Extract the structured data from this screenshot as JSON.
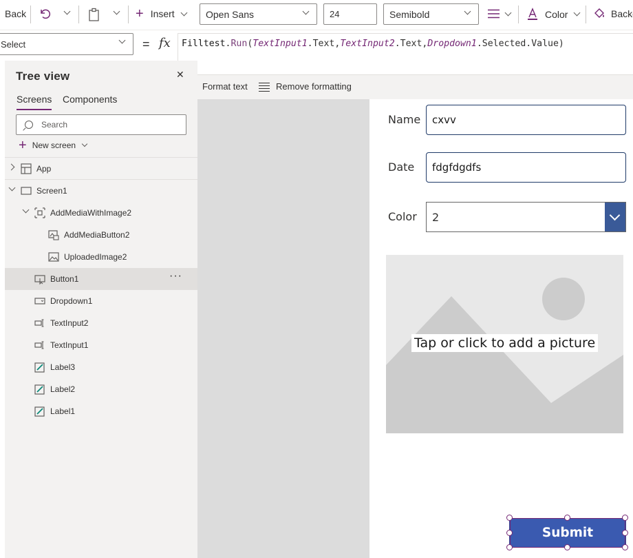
{
  "toolbar": {
    "back_label": "Back",
    "insert_label": "Insert",
    "font_family": "Open Sans",
    "font_size": "24",
    "font_weight": "Semibold",
    "color_label": "Color",
    "background_label": "Backg"
  },
  "formula_bar": {
    "property": "Select",
    "equals": "=",
    "fx_label": "fx",
    "formula": {
      "fn": "Filltest",
      "method": "Run",
      "arg1_ctrl": "TextInput1",
      "arg1_prop": ".Text,",
      "arg2_ctrl": "TextInput2",
      "arg2_prop": ".Text,",
      "arg3_ctrl": "Dropdown1",
      "arg3_prop": ".Selected.Value)"
    },
    "format_text_label": "Format text",
    "remove_formatting_label": "Remove formatting"
  },
  "tree": {
    "title": "Tree view",
    "close_glyph": "✕",
    "tabs": [
      "Screens",
      "Components"
    ],
    "search_placeholder": "Search",
    "new_screen_label": "New screen",
    "items": [
      {
        "label": "App",
        "icon": "app-icon"
      },
      {
        "label": "Screen1",
        "icon": "screen-icon"
      },
      {
        "label": "AddMediaWithImage2",
        "icon": "group-icon"
      },
      {
        "label": "AddMediaButton2",
        "icon": "add-media-icon"
      },
      {
        "label": "UploadedImage2",
        "icon": "image-icon"
      },
      {
        "label": "Button1",
        "icon": "button-icon",
        "selected": true
      },
      {
        "label": "Dropdown1",
        "icon": "dropdown-icon"
      },
      {
        "label": "TextInput2",
        "icon": "text-input-icon"
      },
      {
        "label": "TextInput1",
        "icon": "text-input-icon"
      },
      {
        "label": "Label3",
        "icon": "label-icon"
      },
      {
        "label": "Label2",
        "icon": "label-icon"
      },
      {
        "label": "Label1",
        "icon": "label-icon"
      }
    ],
    "more_glyph": "···"
  },
  "screen": {
    "name_label": "Name",
    "name_value": "cxvv",
    "date_label": "Date",
    "date_value": "fdgfdgdfs",
    "color_label": "Color",
    "color_value": "2",
    "image_hint": "Tap or click to add a picture",
    "submit_label": "Submit"
  },
  "colors": {
    "accent": "#742774",
    "submit_bg": "#3a5ab0",
    "dropdown_btn": "#3a5a98",
    "input_border": "#1f3a68",
    "canvas_bg": "#dcdcdc",
    "pane_bg": "#f3f2f1"
  }
}
